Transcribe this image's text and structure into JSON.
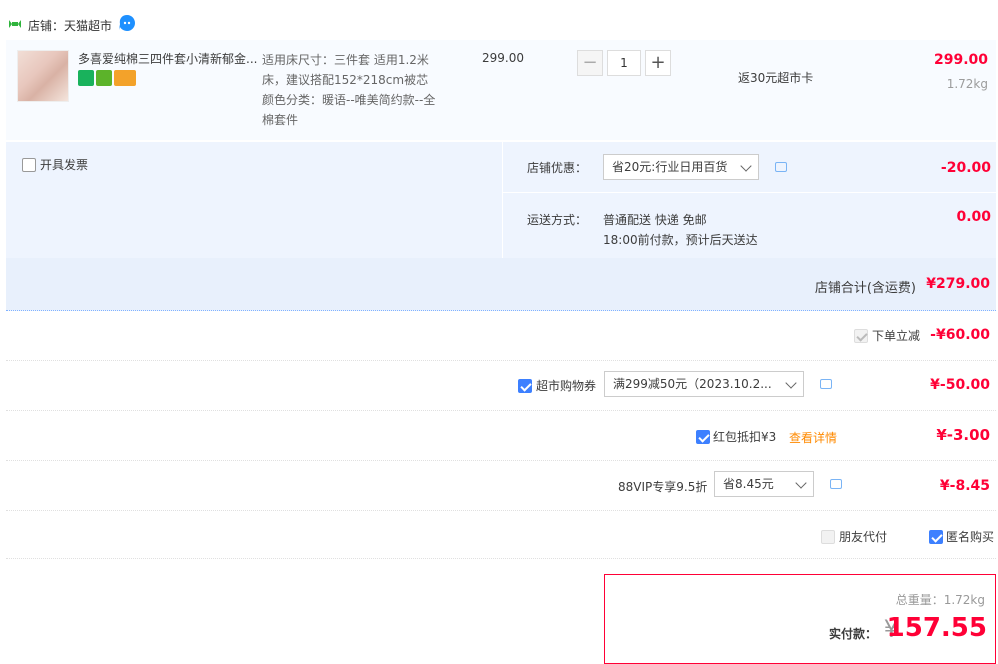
{
  "shop": {
    "label": "店铺：天猫超市",
    "icon": "shop-icon",
    "ww_icon": "wangwang-icon"
  },
  "item": {
    "title": "多喜爱纯棉三四件套小清新郁金...",
    "sku_line1": "适用床尺寸：三件套 适用1.2米",
    "sku_line2": "床，建议搭配152*218cm被芯",
    "sku_line3": "颜色分类：暖语--唯美简约款--全",
    "sku_line4": "棉套件",
    "price": "299.00",
    "quantity": "1",
    "minus": "−",
    "plus": "+",
    "rebate": "返30元超市卡",
    "total": "299.00",
    "weight": "1.72kg"
  },
  "options": {
    "invoice_label": "开具发票",
    "shop_discount_label": "店铺优惠：",
    "shop_discount_select": "省20元:行业日用百货",
    "shop_discount_amount": "-20.00",
    "delivery_label": "运送方式：",
    "delivery_line1": "普通配送 快递 免邮",
    "delivery_line2": "18:00前付款，预计后天送达",
    "delivery_amount": "0.00",
    "shop_total_label": "店铺合计(含运费)",
    "shop_total_amount": "¥279.00"
  },
  "discounts": {
    "instant_label": "下单立减",
    "instant_amount": "-¥60.00",
    "coupon_label": "超市购物券",
    "coupon_select": "满299减50元（2023.10.2...",
    "coupon_amount": "¥-50.00",
    "redpack_label": "红包抵扣¥3",
    "redpack_link": "查看详情",
    "redpack_amount": "¥-3.00",
    "vip_label": "88VIP专享9.5折",
    "vip_select": "省8.45元",
    "vip_amount": "¥-8.45",
    "friend_pay_label": "朋友代付",
    "anon_label": "匿名购买"
  },
  "payment": {
    "weight_label": "总重量：1.72kg",
    "pay_label": "实付款：",
    "yen": "¥",
    "amount": "157.55"
  },
  "colors": {
    "accent_red": "#ff0036",
    "checkbox_blue": "#3d80ff",
    "panel_blue": "#eef4fe"
  }
}
